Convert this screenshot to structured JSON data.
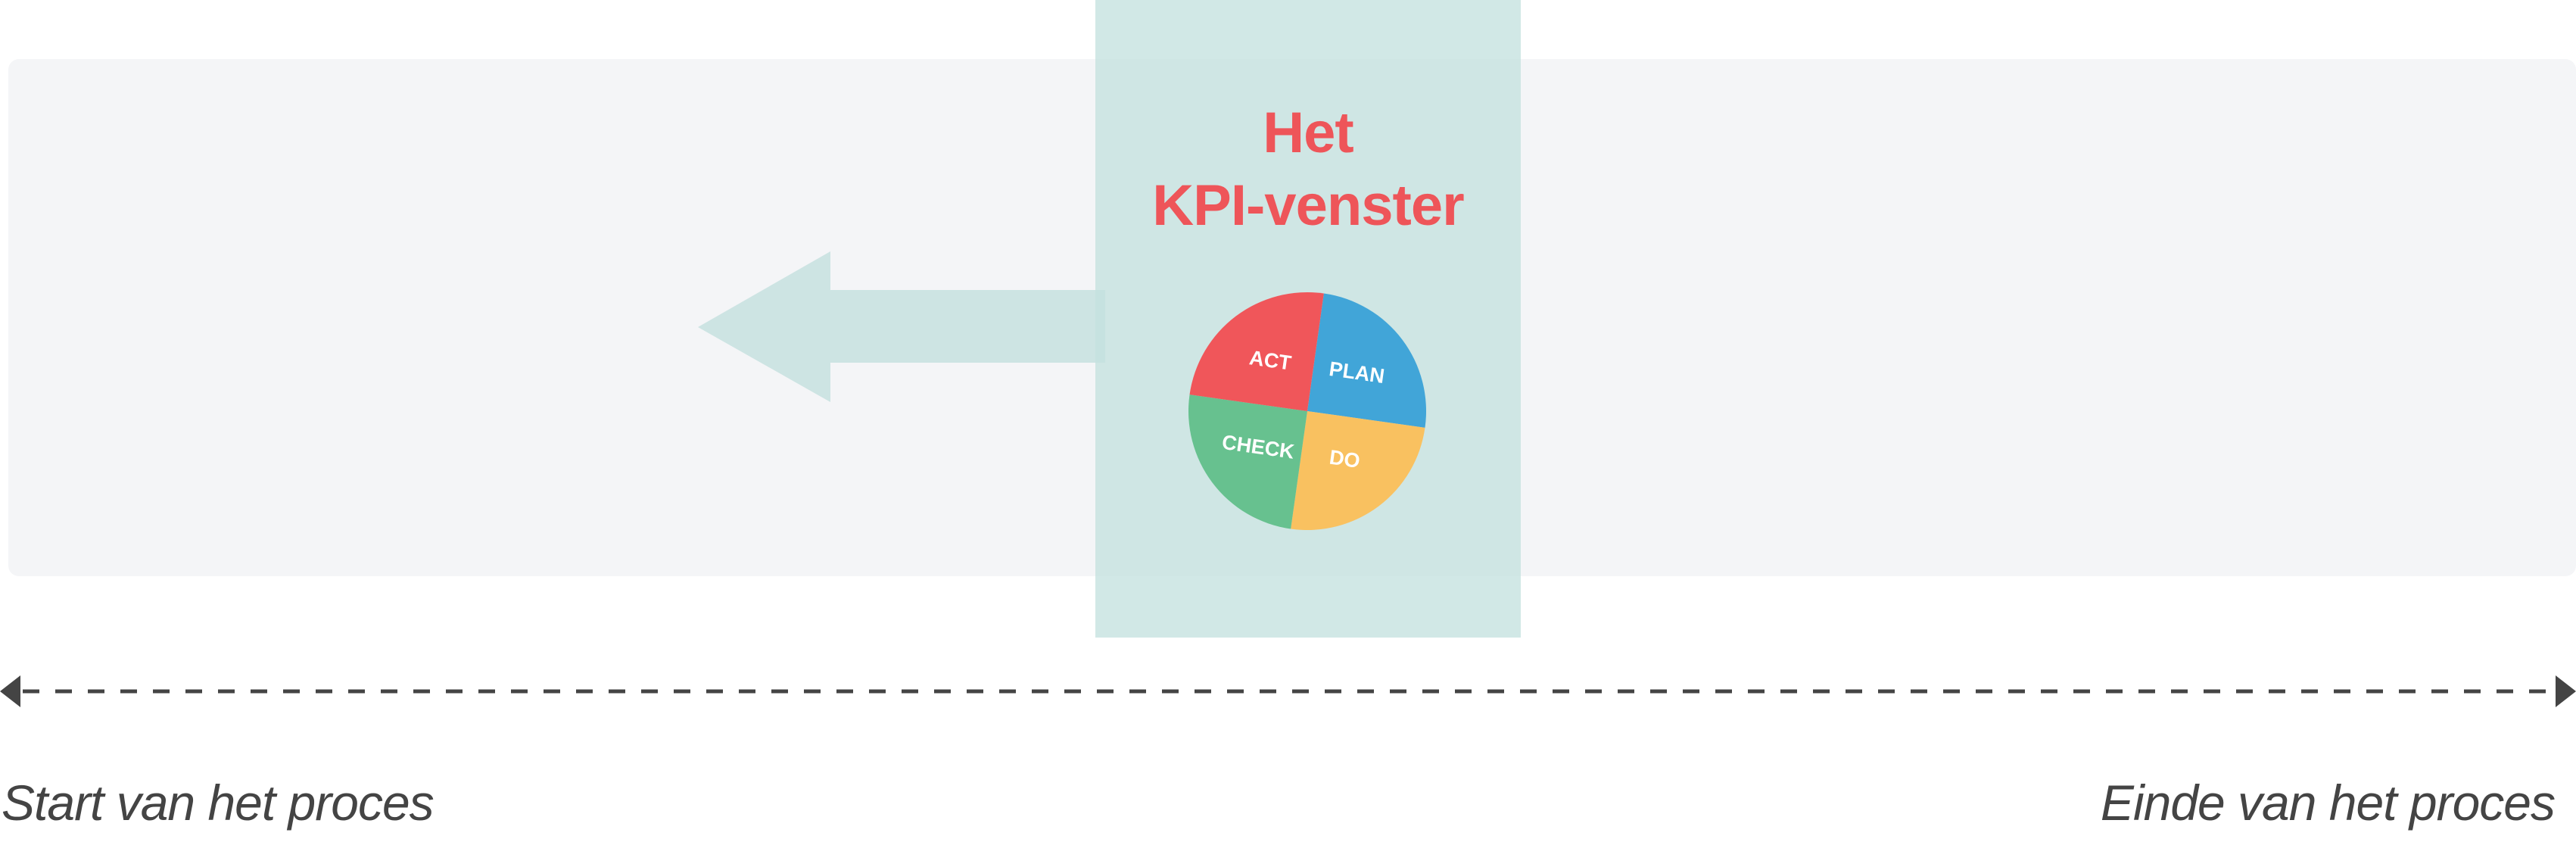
{
  "kpi_window": {
    "title_line1": "Het",
    "title_line2": "KPI-venster",
    "title_color": "#ee5559",
    "fill_color": "#c4e1df"
  },
  "pdca_cycle": {
    "segments": [
      {
        "label": "PLAN",
        "color": "#41a5d8"
      },
      {
        "label": "DO",
        "color": "#f9c160"
      },
      {
        "label": "CHECK",
        "color": "#67c18f"
      },
      {
        "label": "ACT",
        "color": "#f0565a"
      }
    ]
  },
  "arrow": {
    "direction": "left",
    "color": "#cde4e3"
  },
  "timeline": {
    "start_label": "Start van het proces",
    "end_label": "Einde van het proces",
    "line_color": "#444444"
  },
  "colors": {
    "panel_bg": "#f4f5f7",
    "page_bg": "#ffffff"
  }
}
